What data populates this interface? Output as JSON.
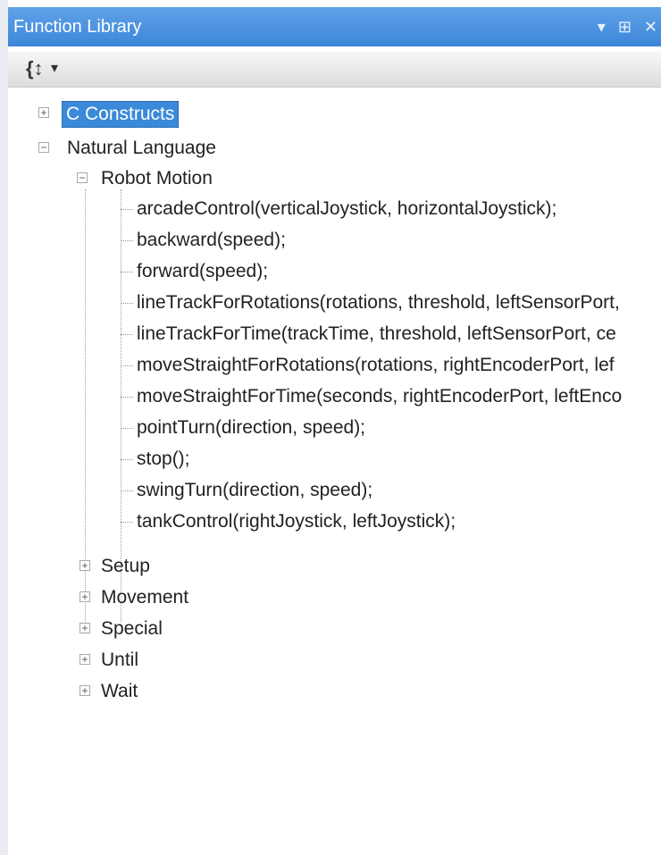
{
  "window": {
    "title": "Function Library",
    "pin_glyph": "▾",
    "dock_glyph": "⊞",
    "close_glyph": "✕"
  },
  "toolbar": {
    "sort_glyph": "{↕",
    "dropdown_glyph": "▾"
  },
  "tree": {
    "c_constructs": "C Constructs",
    "natural_language": "Natural Language",
    "robot_motion": "Robot Motion",
    "functions": [
      "arcadeControl(verticalJoystick, horizontalJoystick);",
      "backward(speed);",
      "forward(speed);",
      "lineTrackForRotations(rotations, threshold, leftSensorPort,",
      "lineTrackForTime(trackTime, threshold, leftSensorPort, ce",
      "moveStraightForRotations(rotations, rightEncoderPort, lef",
      "moveStraightForTime(seconds, rightEncoderPort, leftEnco",
      "pointTurn(direction, speed);",
      "stop();",
      "swingTurn(direction, speed);",
      "tankControl(rightJoystick, leftJoystick);"
    ],
    "groups": [
      "Setup",
      "Movement",
      "Special",
      "Until",
      "Wait"
    ],
    "expand_glyph": "+",
    "collapse_glyph": "−"
  }
}
